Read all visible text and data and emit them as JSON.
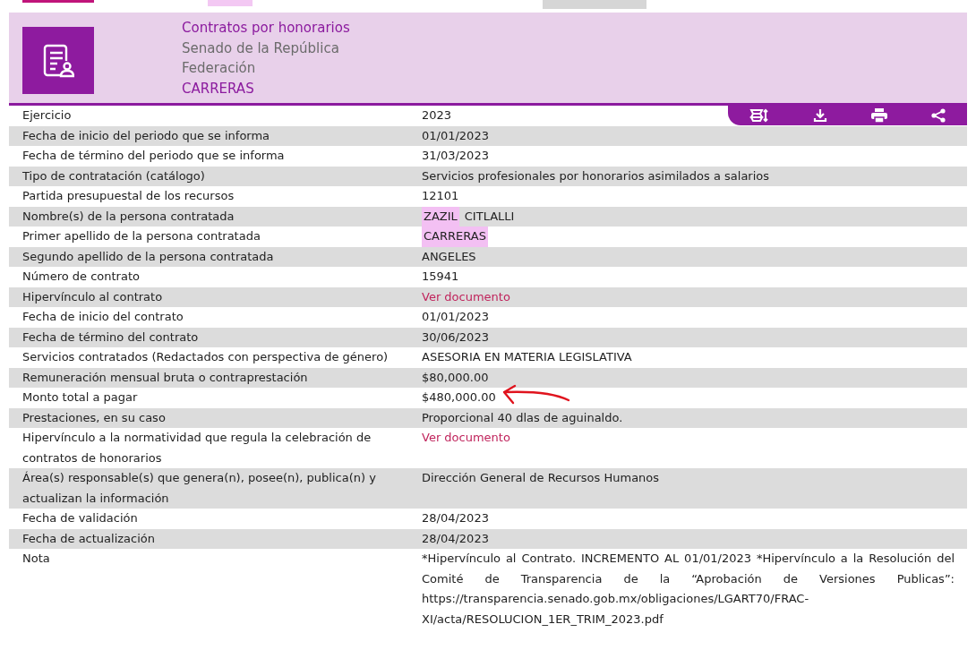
{
  "header": {
    "title": "Contratos por honorarios",
    "lines": [
      "Senado de la República",
      "Federación"
    ],
    "tag": "CARRERAS"
  },
  "rows": [
    {
      "label": "Ejercicio",
      "kind": "text",
      "value": "2023"
    },
    {
      "label": "Fecha de inicio del periodo que se informa",
      "kind": "text",
      "value": "01/01/2023"
    },
    {
      "label": "Fecha de término del periodo que se informa",
      "kind": "text",
      "value": "31/03/2023"
    },
    {
      "label": "Tipo de contratación (catálogo)",
      "kind": "text",
      "value": "Servicios profesionales por honorarios asimilados a salarios"
    },
    {
      "label": "Partida presupuestal de los recursos",
      "kind": "text",
      "value": "12101"
    },
    {
      "label": "Nombre(s) de la persona contratada",
      "kind": "parts",
      "parts": [
        {
          "text": "ZAZIL",
          "highlighted": true
        },
        {
          "text": "CITLALLI",
          "highlighted": false
        }
      ]
    },
    {
      "label": "Primer apellido de la persona contratada",
      "kind": "parts",
      "parts": [
        {
          "text": "CARRERAS",
          "highlighted": true
        }
      ]
    },
    {
      "label": "Segundo apellido de la persona contratada",
      "kind": "text",
      "value": "ANGELES"
    },
    {
      "label": "Número de contrato",
      "kind": "text",
      "value": "15941"
    },
    {
      "label": "Hipervínculo al contrato",
      "kind": "link",
      "value": "Ver documento"
    },
    {
      "label": "Fecha de inicio del contrato",
      "kind": "text",
      "value": "01/01/2023"
    },
    {
      "label": "Fecha de término del contrato",
      "kind": "text",
      "value": "30/06/2023"
    },
    {
      "label": "Servicios contratados (Redactados con perspectiva de género)",
      "kind": "text",
      "value": "ASESORIA EN MATERIA LEGISLATIVA"
    },
    {
      "label": "Remuneración mensual bruta o contraprestación",
      "kind": "text",
      "value": "$80,000.00"
    },
    {
      "label": "Monto total a pagar",
      "kind": "text",
      "value": "$480,000.00",
      "annotated": true
    },
    {
      "label": "Prestaciones, en su caso",
      "kind": "text",
      "value": "Proporcional 40 dlas de aguinaldo."
    },
    {
      "label": "Hipervínculo a la normatividad que regula la celebración de contratos de honorarios",
      "kind": "link",
      "value": "Ver documento"
    },
    {
      "label": "Área(s) responsable(s) que genera(n), posee(n), publica(n) y actualizan la información",
      "kind": "text",
      "value": "Dirección General de Recursos Humanos"
    },
    {
      "label": "Fecha de validación",
      "kind": "text",
      "value": "28/04/2023"
    },
    {
      "label": "Fecha de actualización",
      "kind": "text",
      "value": "28/04/2023"
    },
    {
      "label": "Nota",
      "kind": "note",
      "value": "*Hipervínculo al Contrato. INCREMENTO AL 01/01/2023 *Hipervínculo a la Resolución del Comité de Transparencia de la “Aprobación de Versiones Publicas”: https://transparencia.senado.gob.mx/obligaciones/LGART70/FRAC-XI/acta/RESOLUCION_1ER_TRIM_2023.pdf"
    }
  ]
}
